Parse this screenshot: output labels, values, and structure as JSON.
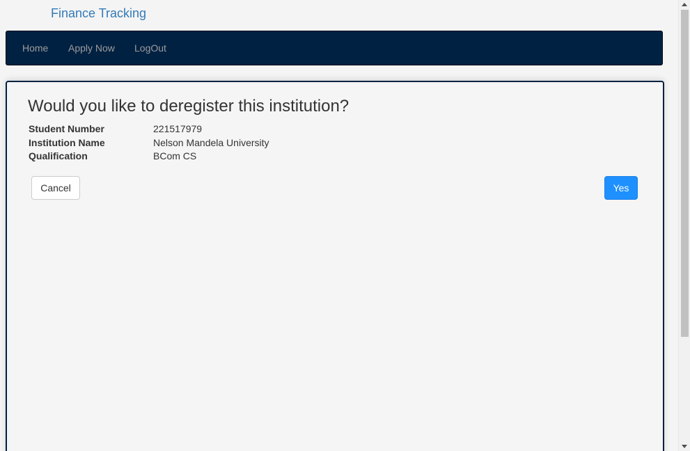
{
  "brand": "Finance Tracking",
  "nav": {
    "home": "Home",
    "apply_now": "Apply Now",
    "logout": "LogOut"
  },
  "dialog": {
    "title": "Would you like to deregister this institution?",
    "fields": [
      {
        "label": "Student Number",
        "value": "221517979"
      },
      {
        "label": "Institution Name",
        "value": "Nelson Mandela University"
      },
      {
        "label": "Qualification",
        "value": "BCom CS"
      }
    ],
    "cancel_label": "Cancel",
    "confirm_label": "Yes"
  },
  "colors": {
    "navbar": "#012142",
    "brand_link": "#337ab7",
    "confirm_button": "#1e90ff"
  },
  "icons": {
    "scroll_up": "chevron-up-icon",
    "scroll_down": "chevron-down-icon"
  }
}
